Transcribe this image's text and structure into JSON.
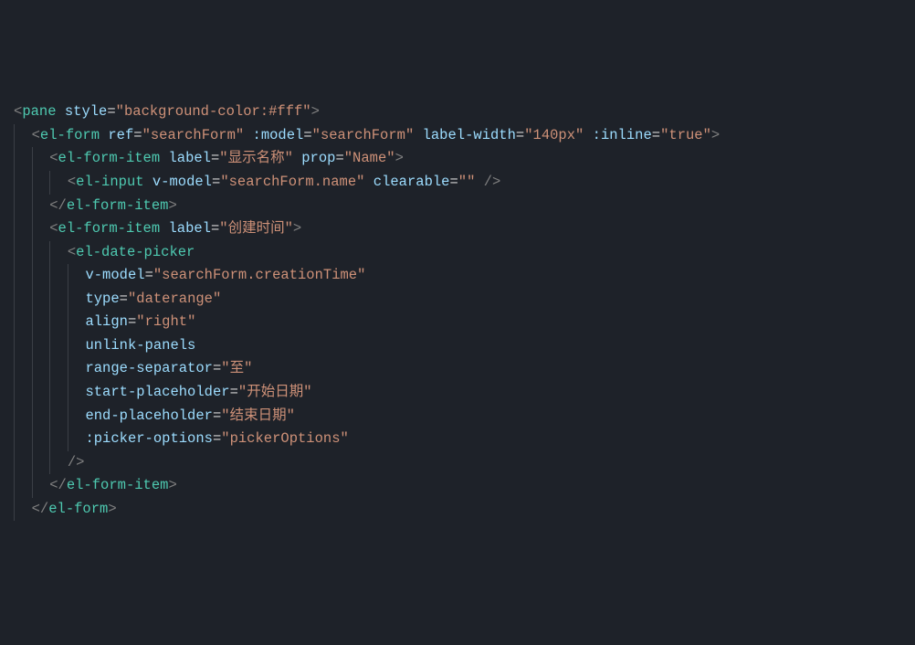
{
  "code": {
    "lines": [
      {
        "indent": 0,
        "tokens": [
          [
            "angle",
            "<"
          ],
          [
            "tag",
            "pane"
          ],
          [
            "text",
            " "
          ],
          [
            "attr",
            "style"
          ],
          [
            "eq",
            "="
          ],
          [
            "str",
            "\"background-color:#fff\""
          ],
          [
            "angle",
            ">"
          ]
        ]
      },
      {
        "indent": 1,
        "tokens": [
          [
            "angle",
            "<"
          ],
          [
            "tag",
            "el-form"
          ],
          [
            "text",
            " "
          ],
          [
            "attr",
            "ref"
          ],
          [
            "eq",
            "="
          ],
          [
            "str",
            "\"searchForm\""
          ],
          [
            "text",
            " "
          ],
          [
            "attr",
            ":model"
          ],
          [
            "eq",
            "="
          ],
          [
            "str",
            "\"searchForm\""
          ],
          [
            "text",
            " "
          ],
          [
            "attr",
            "label-width"
          ],
          [
            "eq",
            "="
          ],
          [
            "str",
            "\"140px\""
          ],
          [
            "text",
            " "
          ],
          [
            "attr",
            ":inline"
          ],
          [
            "eq",
            "="
          ],
          [
            "str",
            "\"true\""
          ],
          [
            "angle",
            ">"
          ]
        ]
      },
      {
        "indent": 2,
        "tokens": [
          [
            "angle",
            "<"
          ],
          [
            "tag",
            "el-form-item"
          ],
          [
            "text",
            " "
          ],
          [
            "attr",
            "label"
          ],
          [
            "eq",
            "="
          ],
          [
            "str",
            "\"显示名称\""
          ],
          [
            "text",
            " "
          ],
          [
            "attr",
            "prop"
          ],
          [
            "eq",
            "="
          ],
          [
            "str",
            "\"Name\""
          ],
          [
            "angle",
            ">"
          ]
        ]
      },
      {
        "indent": 3,
        "tokens": [
          [
            "angle",
            "<"
          ],
          [
            "tag",
            "el-input"
          ],
          [
            "text",
            " "
          ],
          [
            "attr",
            "v-model"
          ],
          [
            "eq",
            "="
          ],
          [
            "str",
            "\"searchForm.name\""
          ],
          [
            "text",
            " "
          ],
          [
            "attr",
            "clearable"
          ],
          [
            "eq",
            "="
          ],
          [
            "str",
            "\"\""
          ],
          [
            "text",
            " "
          ],
          [
            "angle",
            "/>"
          ]
        ]
      },
      {
        "indent": 2,
        "tokens": [
          [
            "angle",
            "</"
          ],
          [
            "tag",
            "el-form-item"
          ],
          [
            "angle",
            ">"
          ]
        ]
      },
      {
        "indent": 2,
        "tokens": [
          [
            "angle",
            "<"
          ],
          [
            "tag",
            "el-form-item"
          ],
          [
            "text",
            " "
          ],
          [
            "attr",
            "label"
          ],
          [
            "eq",
            "="
          ],
          [
            "str",
            "\"创建时间\""
          ],
          [
            "angle",
            ">"
          ]
        ]
      },
      {
        "indent": 3,
        "tokens": [
          [
            "angle",
            "<"
          ],
          [
            "tag",
            "el-date-picker"
          ]
        ]
      },
      {
        "indent": 4,
        "tokens": [
          [
            "attr",
            "v-model"
          ],
          [
            "eq",
            "="
          ],
          [
            "str",
            "\"searchForm.creationTime\""
          ]
        ]
      },
      {
        "indent": 4,
        "tokens": [
          [
            "attr",
            "type"
          ],
          [
            "eq",
            "="
          ],
          [
            "str",
            "\"daterange\""
          ]
        ]
      },
      {
        "indent": 4,
        "tokens": [
          [
            "attr",
            "align"
          ],
          [
            "eq",
            "="
          ],
          [
            "str",
            "\"right\""
          ]
        ]
      },
      {
        "indent": 4,
        "tokens": [
          [
            "attr",
            "unlink-panels"
          ]
        ]
      },
      {
        "indent": 4,
        "tokens": [
          [
            "attr",
            "range-separator"
          ],
          [
            "eq",
            "="
          ],
          [
            "str",
            "\"至\""
          ]
        ]
      },
      {
        "indent": 4,
        "tokens": [
          [
            "attr",
            "start-placeholder"
          ],
          [
            "eq",
            "="
          ],
          [
            "str",
            "\"开始日期\""
          ]
        ]
      },
      {
        "indent": 4,
        "tokens": [
          [
            "attr",
            "end-placeholder"
          ],
          [
            "eq",
            "="
          ],
          [
            "str",
            "\"结束日期\""
          ]
        ]
      },
      {
        "indent": 4,
        "tokens": [
          [
            "attr",
            ":picker-options"
          ],
          [
            "eq",
            "="
          ],
          [
            "str",
            "\"pickerOptions\""
          ]
        ]
      },
      {
        "indent": 3,
        "tokens": [
          [
            "angle",
            "/>"
          ]
        ]
      },
      {
        "indent": 2,
        "tokens": [
          [
            "angle",
            "</"
          ],
          [
            "tag",
            "el-form-item"
          ],
          [
            "angle",
            ">"
          ]
        ]
      },
      {
        "indent": 1,
        "tokens": [
          [
            "angle",
            "</"
          ],
          [
            "tag",
            "el-form"
          ],
          [
            "angle",
            ">"
          ]
        ]
      }
    ],
    "indentUnit": "  "
  }
}
